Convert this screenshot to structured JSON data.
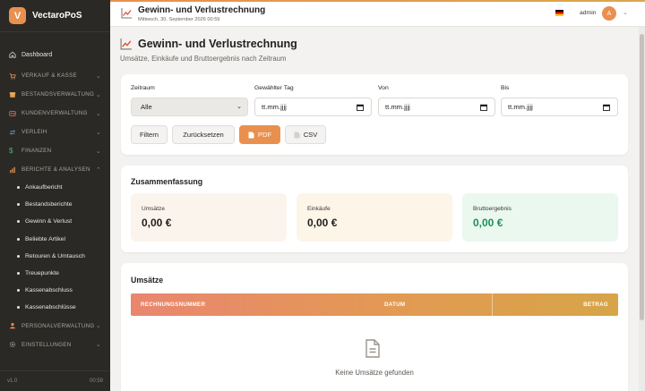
{
  "app": {
    "name": "VectaroPoS",
    "logo_letter": "V",
    "version": "v1.0",
    "time": "00:59"
  },
  "header": {
    "title": "Gewinn- und Verlustrechnung",
    "subtitle": "Mittwoch, 30. September 2026 00:59",
    "user": "admin",
    "avatar_letter": "A"
  },
  "sidebar": {
    "dashboard": "Dashboard",
    "sections": [
      {
        "label": "VERKAUF & KASSE",
        "icon": "cart-icon"
      },
      {
        "label": "BESTANDSVERWALTUNG",
        "icon": "box-icon"
      },
      {
        "label": "KUNDENVERWALTUNG",
        "icon": "people-icon"
      },
      {
        "label": "VERLEIH",
        "icon": "swap-icon"
      },
      {
        "label": "FINANZEN",
        "icon": "dollar-icon"
      },
      {
        "label": "BERICHTE & ANALYSEN",
        "icon": "chart-icon"
      }
    ],
    "reports": [
      "Ankaufbericht",
      "Bestandsberichte",
      "Gewinn & Verlust",
      "Beliebte Artikel",
      "Retouren & Umtausch",
      "Treuepunkte",
      "Kassenabschluss",
      "Kassenabschlüsse"
    ],
    "bottom_sections": [
      {
        "label": "PERSONALVERWALTUNG",
        "icon": "person-icon"
      },
      {
        "label": "EINSTELLUNGEN",
        "icon": "gear-icon"
      }
    ]
  },
  "page": {
    "title": "Gewinn- und Verlustrechnung",
    "subtitle": "Umsätze, Einkäufe und Bruttoergebnis nach Zeitraum"
  },
  "filters": {
    "period_label": "Zeitraum",
    "period_value": "Alle",
    "day_label": "Gewählter Tag",
    "from_label": "Von",
    "to_label": "Bis",
    "date_placeholder": "tt.mm.jjjj",
    "filter_btn": "Filtern",
    "reset_btn": "Zurücksetzen",
    "pdf_btn": "PDF",
    "csv_btn": "CSV"
  },
  "summary": {
    "title": "Zusammenfassung",
    "stats": [
      {
        "label": "Umsätze",
        "value": "0,00 €"
      },
      {
        "label": "Einkäufe",
        "value": "0,00 €"
      },
      {
        "label": "Bruttoergebnis",
        "value": "0,00 €"
      }
    ]
  },
  "sales": {
    "title": "Umsätze",
    "columns": [
      "RECHNUNGSNUMMER",
      "DATUM",
      "BETRAG"
    ],
    "empty": "Keine Umsätze gefunden"
  },
  "colors": {
    "accent": "#e9904f",
    "sidebar": "#2b2926",
    "positive": "#1f8f57"
  }
}
